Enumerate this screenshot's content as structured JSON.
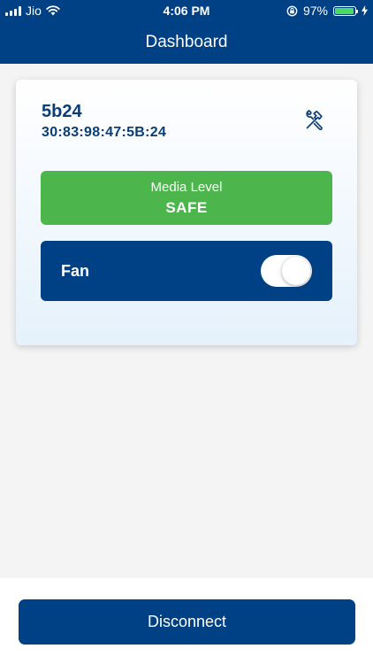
{
  "status_bar": {
    "carrier": "Jio",
    "time": "4:06 PM",
    "battery": "97%",
    "battery_level": 0.97
  },
  "header": {
    "title": "Dashboard"
  },
  "device": {
    "name": "5b24",
    "mac": "30:83:98:47:5B:24",
    "settings_icon": "tools-icon"
  },
  "media_level": {
    "label": "Media Level",
    "value": "SAFE",
    "color": "#4cb64c"
  },
  "fan": {
    "label": "Fan",
    "toggle_state": "on"
  },
  "footer": {
    "disconnect_label": "Disconnect"
  },
  "colors": {
    "brand_blue": "#004185",
    "text_blue": "#0a3e75",
    "safe_green": "#4cb64c"
  }
}
